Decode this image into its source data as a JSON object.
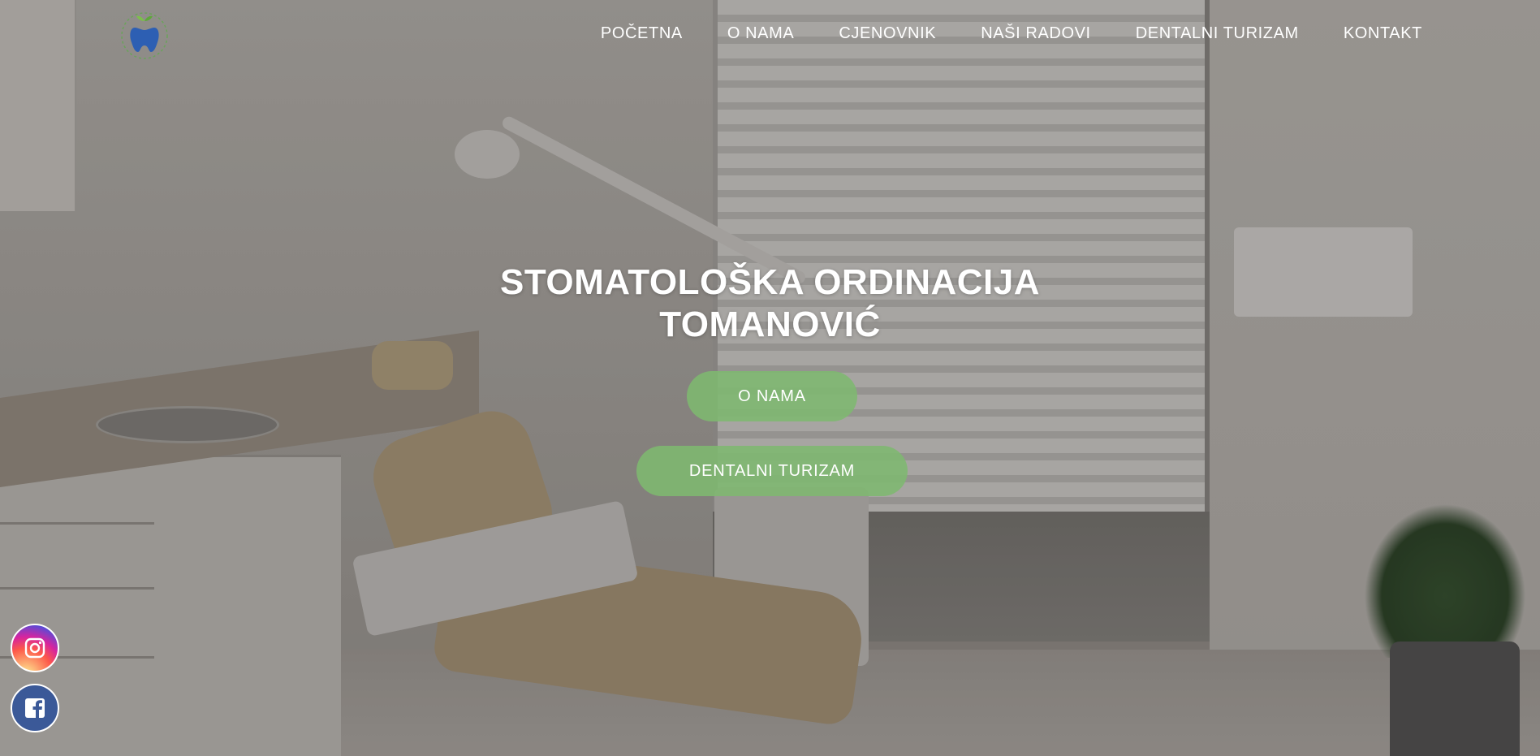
{
  "header": {
    "logo_icon": "tooth-apple-logo",
    "nav": [
      {
        "label": "POČETNA"
      },
      {
        "label": "O NAMA"
      },
      {
        "label": "CJENOVNIK"
      },
      {
        "label": "NAŠI RADOVI"
      },
      {
        "label": "DENTALNI TURIZAM"
      },
      {
        "label": "KONTAKT"
      }
    ]
  },
  "hero": {
    "title_line1": "STOMATOLOŠKA ORDINACIJA",
    "title_line2": "TOMANOVIĆ",
    "buttons": {
      "about": "O NAMA",
      "tourism": "DENTALNI TURIZAM"
    },
    "button_color": "#7eb870"
  },
  "social": {
    "instagram_icon": "instagram-icon",
    "facebook_icon": "facebook-icon"
  }
}
